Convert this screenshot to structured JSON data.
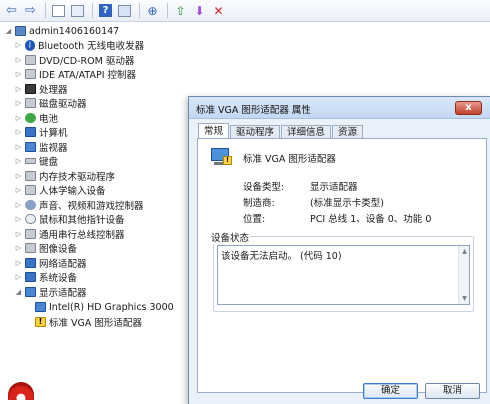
{
  "toolbar": {
    "buttons": [
      "back-arrow",
      "forward-arrow",
      "window-box",
      "window-box-2",
      "help",
      "console",
      "scan-hardware",
      "update-driver",
      "disable-device",
      "uninstall-device"
    ]
  },
  "tree": {
    "root": "admin1406160147",
    "items": [
      {
        "label": "Bluetooth 无线电收发器",
        "icon": "bluetooth-icon"
      },
      {
        "label": "DVD/CD-ROM 驱动器",
        "icon": "dvd-drive-icon"
      },
      {
        "label": "IDE ATA/ATAPI 控制器",
        "icon": "ide-controller-icon"
      },
      {
        "label": "处理器",
        "icon": "processor-icon"
      },
      {
        "label": "磁盘驱动器",
        "icon": "disk-drive-icon"
      },
      {
        "label": "电池",
        "icon": "battery-icon"
      },
      {
        "label": "计算机",
        "icon": "computer-icon"
      },
      {
        "label": "监视器",
        "icon": "monitor-icon"
      },
      {
        "label": "键盘",
        "icon": "keyboard-icon"
      },
      {
        "label": "内存技术驱动程序",
        "icon": "memory-icon"
      },
      {
        "label": "人体学输入设备",
        "icon": "hid-icon"
      },
      {
        "label": "声音、视频和游戏控制器",
        "icon": "sound-icon"
      },
      {
        "label": "鼠标和其他指针设备",
        "icon": "mouse-icon"
      },
      {
        "label": "通用串行总线控制器",
        "icon": "usb-icon"
      },
      {
        "label": "图像设备",
        "icon": "camera-icon"
      },
      {
        "label": "网络适配器",
        "icon": "network-icon"
      },
      {
        "label": "系统设备",
        "icon": "system-device-icon"
      },
      {
        "label": "显示适配器",
        "icon": "display-adapter-icon"
      }
    ],
    "children": [
      {
        "label": "Intel(R) HD Graphics 3000",
        "icon": "display-adapter-icon"
      },
      {
        "label": "标准 VGA 图形适配器",
        "icon": "display-adapter-warning-icon"
      }
    ]
  },
  "dialog": {
    "title": "标准 VGA 图形适配器 属性",
    "close": "x",
    "tabs": [
      "常规",
      "驱动程序",
      "详细信息",
      "资源"
    ],
    "device_name": "标准 VGA 图形适配器",
    "props": [
      {
        "label": "设备类型:",
        "value": "显示适配器"
      },
      {
        "label": "制造商:",
        "value": "(标准显示卡类型)"
      },
      {
        "label": "位置:",
        "value": "PCI 总线 1、设备 0、功能 0"
      }
    ],
    "status_group": "设备状态",
    "status_text": "该设备无法启动。 (代码 10)",
    "ok": "确定",
    "cancel": "取消"
  }
}
